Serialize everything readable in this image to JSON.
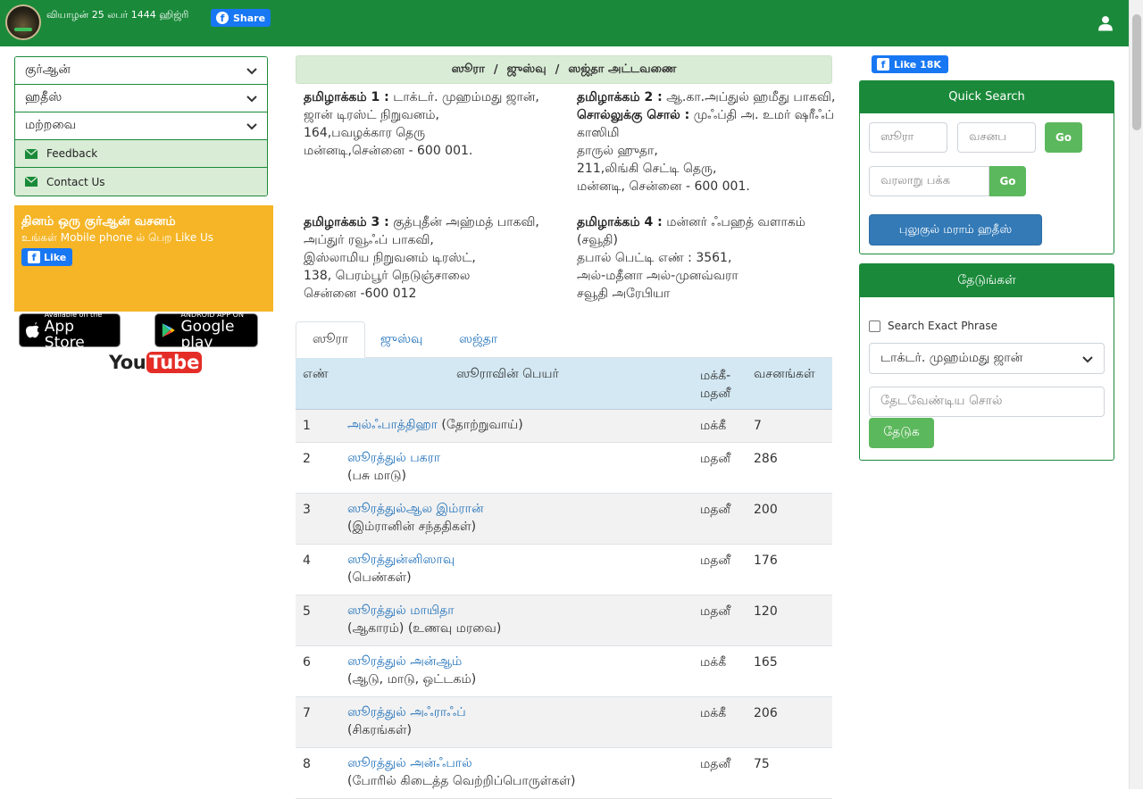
{
  "header": {
    "date": "வியாழன் 25 லபர் 1444 ஹிஜ்ரி",
    "share_label": "Share"
  },
  "leftmenu": {
    "items": [
      "குர்ஆன்",
      "ஹதீஸ்",
      "மற்றவை"
    ],
    "links": [
      "Feedback",
      "Contact Us"
    ]
  },
  "promo": {
    "line1": "தினம் ஒரு குர்ஆன் வசனம்",
    "line2": "உங்கள் Mobile phone ல் பெற Like Us",
    "like_label": "Like"
  },
  "apps": {
    "appstore_small": "Available on the",
    "appstore_big": "App Store",
    "gplay_small": "ANDROID APP ON",
    "gplay_big": "Google play",
    "youtube_you": "You",
    "youtube_tube": "Tube"
  },
  "breadcrumb": [
    "ஸூரா",
    "/",
    "ஜுஸ்வு",
    "/",
    "ஸஜ்தா அட்டவணை"
  ],
  "credits": [
    {
      "label": "தமிழாக்கம் 1 :",
      "lines": [
        "டாக்டர். முஹம்மது ஜான்,",
        "ஜான் டிரஸ்ட் நிறுவனம்,",
        "164,பவழக்கார தெரு",
        "மன்னடி,சென்னை - 600 001."
      ]
    },
    {
      "label": "தமிழாக்கம் 2 :",
      "lines": [
        "ஆ.கா.அப்துல் ஹமீது பாகவி,"
      ]
    },
    {
      "label": "சொல்லுக்கு சொல் :",
      "lines": [
        "முஃப்தி அ. உமர் ஷரீஃப் காஸிமி",
        "தாருல் ஹுதா,",
        "211,லிங்கி செட்டி தெரு,",
        "மன்னடி, சென்னை - 600 001."
      ]
    },
    {
      "label": "தமிழாக்கம் 3 :",
      "lines": [
        "குத்புதீன் அஹ்மத் பாகவி,",
        "அப்துர் ரவூஃப் பாகவி,",
        "இஸ்லாமிய நிறுவனம் டிரஸ்ட்,",
        "138, பெரம்பூர் நெடுஞ்சாலை",
        "சென்னை -600 012"
      ]
    },
    {
      "label": "தமிழாக்கம் 4 :",
      "lines": [
        "மன்னர் ஃபஹத் வளாகம் (சவூதி)",
        "தபால் பெட்டி எண் : 3561,",
        "அல்-மதீனா அல்-முனவ்வரா",
        "சவூதி அரேபியா"
      ]
    }
  ],
  "tabs": [
    "ஸூரா",
    "ஜுஸ்வு",
    "ஸஜ்தா"
  ],
  "table": {
    "headers": [
      "எண்",
      "ஸூராவின் பெயர்",
      "மக்கீ-மதனீ",
      "வசனங்கள்"
    ],
    "rows": [
      {
        "num": "1",
        "name": "அல்ஃபாத்திஹா",
        "meaning": "(தோற்றுவாய்)",
        "type": "மக்கீ",
        "verses": "7"
      },
      {
        "num": "2",
        "name": "ஸூரத்துல் பகரா",
        "meaning": "(பசு மாடு)",
        "type": "மதனீ",
        "verses": "286"
      },
      {
        "num": "3",
        "name": "ஸூரத்துல்ஆல இம்ரான்",
        "meaning": "(இம்ரானின் சந்ததிகள்)",
        "type": "மதனீ",
        "verses": "200"
      },
      {
        "num": "4",
        "name": "ஸூரத்துன்னிஸாவு",
        "meaning": "(பெண்கள்)",
        "type": "மதனீ",
        "verses": "176"
      },
      {
        "num": "5",
        "name": "ஸூரத்துல் மாயிதா",
        "meaning": "(ஆகாரம்) (உணவு மரவை)",
        "type": "மதனீ",
        "verses": "120"
      },
      {
        "num": "6",
        "name": "ஸூரத்துல் அன்ஆம்",
        "meaning": "(ஆடு, மாடு, ஒட்டகம்)",
        "type": "மக்கீ",
        "verses": "165"
      },
      {
        "num": "7",
        "name": "ஸூரத்துல் அஃராஃப்",
        "meaning": "(சிகரங்கள்)",
        "type": "மக்கீ",
        "verses": "206"
      },
      {
        "num": "8",
        "name": "ஸூரத்துல் அன்ஃபால்",
        "meaning": "(போரில் கிடைத்த வெற்றிப்பொருள்கள்)",
        "type": "மதனீ",
        "verses": "75"
      }
    ]
  },
  "right": {
    "fb_like_label": "Like 18K",
    "quick_search": {
      "title": "Quick Search",
      "sura_placeholder": "ஸூரா",
      "verse_placeholder": "வசனப",
      "go_label": "Go",
      "history_placeholder": "வரலாறு பக்க",
      "bukhari_label": "புலுகுல் மராம் ஹதீஸ்"
    },
    "search": {
      "title": "தேடுங்கள்",
      "exact_label": "Search Exact Phrase",
      "translator_selected": "டாக்டர். முஹம்மது ஜான்",
      "query_placeholder": "தேடவேண்டிய சொல்",
      "submit_label": "தேடுக"
    }
  }
}
